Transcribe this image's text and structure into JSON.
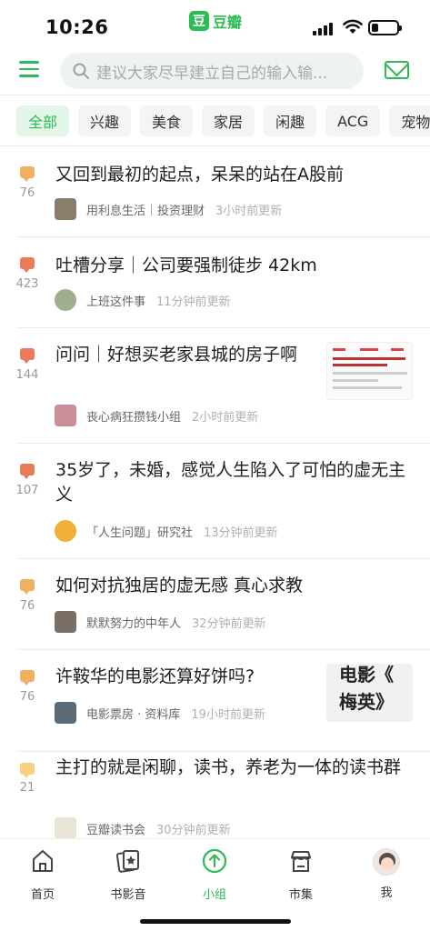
{
  "status_bar": {
    "time": "10:26"
  },
  "app": {
    "logo_char": "豆",
    "name": "豆瓣"
  },
  "header": {
    "search_placeholder": "建议大家尽早建立自己的输入输...",
    "icons": [
      "menu-icon",
      "search-icon",
      "mail-icon"
    ]
  },
  "categories": [
    "全部",
    "兴趣",
    "美食",
    "家居",
    "闲趣",
    "ACG",
    "宠物"
  ],
  "active_category": "全部",
  "posts": [
    {
      "title": "又回到最初的起点，呆呆的站在A股前",
      "comments": "76",
      "comment_color": "#f0b060",
      "group": "用利息生活｜投资理财",
      "updated": "3小时前更新",
      "avatar_color": "#8a7d6c"
    },
    {
      "title": "吐槽分享｜公司要强制徒步 42km",
      "comments": "423",
      "comment_color": "#e87b5b",
      "group": "上班这件事",
      "updated": "11分钟前更新",
      "avatar_color": "#9fae8c"
    },
    {
      "title": "问问｜好想买老家县城的房子啊",
      "comments": "144",
      "comment_color": "#e87b5b",
      "group": "丧心病狂攒钱小组",
      "updated": "2小时前更新",
      "avatar_color": "#c88f98"
    },
    {
      "title": "35岁了，未婚，感觉人生陷入了可怕的虚无主义",
      "comments": "107",
      "comment_color": "#e87b5b",
      "group": "「人生问题」研究社",
      "updated": "13分钟前更新",
      "avatar_color": "#f2b13a"
    },
    {
      "title": "如何对抗独居的虚无感 真心求教",
      "comments": "76",
      "comment_color": "#f0b060",
      "group": "默默努力的中年人",
      "updated": "32分钟前更新",
      "avatar_color": "#7a6f66"
    },
    {
      "title": "许鞍华的电影还算好饼吗?",
      "comments": "76",
      "comment_color": "#f0b060",
      "group": "电影票房 · 资料库",
      "updated": "19小时前更新",
      "avatar_color": "#5a6b7a"
    },
    {
      "title": "主打的就是闲聊，读书，养老为一体的读书群",
      "comments": "21",
      "comment_color": "#f5d080",
      "group": "豆瓣读书会",
      "updated": "30分钟前更新",
      "avatar_color": "#e9e4d6"
    }
  ],
  "thumbnails": {
    "post_3": {
      "icon": "news-screenshot-image"
    },
    "post_6": {
      "line1": "电影《",
      "line2": "梅英》"
    }
  },
  "tabs": [
    {
      "label": "首页",
      "icon": "home-icon"
    },
    {
      "label": "书影音",
      "icon": "book-movie-icon"
    },
    {
      "label": "小组",
      "icon": "group-arrow-icon"
    },
    {
      "label": "市集",
      "icon": "market-icon"
    },
    {
      "label": "我",
      "icon": "profile-avatar"
    }
  ],
  "active_tab": "小组",
  "colors": {
    "accent": "#2dbb55",
    "hot_comment": "#e87b5b",
    "warm_comment": "#f0b060"
  }
}
